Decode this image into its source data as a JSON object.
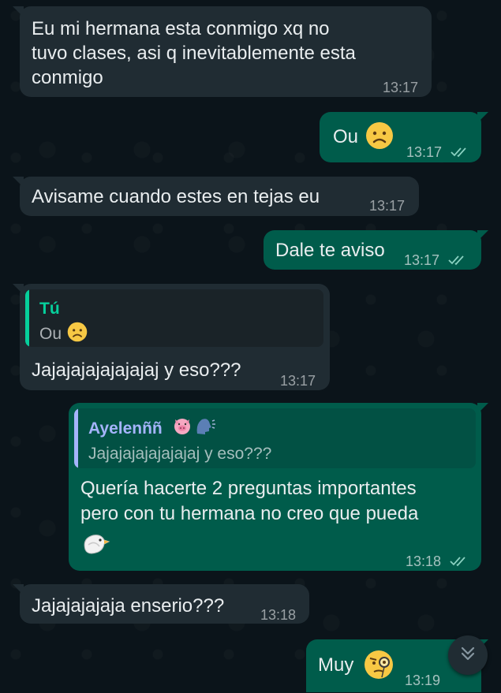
{
  "messages": [
    {
      "text_lines": [
        "Eu mi hermana esta conmigo xq no",
        "tuvo clases,  asi q inevitablemente esta",
        "conmigo"
      ],
      "time": "13:17",
      "direction": "incoming"
    },
    {
      "text": "Ou",
      "emoji": "disappointed-face",
      "time": "13:17",
      "direction": "outgoing",
      "status": "read"
    },
    {
      "text": "Avisame cuando estes en tejas eu",
      "time": "13:17",
      "direction": "incoming"
    },
    {
      "text": "Dale te aviso",
      "time": "13:17",
      "direction": "outgoing",
      "status": "read"
    },
    {
      "quote_author": "Tú",
      "quote_text": "Ou",
      "quote_emoji": "disappointed-face",
      "text": "Jajajajajajajajaj y eso???",
      "time": "13:17",
      "direction": "incoming"
    },
    {
      "quote_author": "Ayelenññ",
      "quote_author_emojis": [
        "pig-face",
        "speaking-head"
      ],
      "quote_text": "Jajajajajajajajaj y eso???",
      "text_lines": [
        "Quería hacerte 2 preguntas importantes",
        "pero con tu hermana no creo que pueda"
      ],
      "emoji": "dove",
      "time": "13:18",
      "direction": "outgoing",
      "status": "read"
    },
    {
      "text": "Jajajajajaja enserio???",
      "time": "13:18",
      "direction": "incoming"
    },
    {
      "text": "Muy",
      "emoji": "face-with-monocle",
      "time": "13:19",
      "direction": "outgoing",
      "status": "read"
    }
  ],
  "colors": {
    "background": "#0b141a",
    "incoming_bubble": "#202c33",
    "outgoing_bubble": "#005c4b",
    "quote_self": "#06cf9c",
    "quote_contact": "#a5b4fc",
    "read_ticks": "#8696a0"
  },
  "icons": {
    "scroll_down": "double-chevron-down-icon"
  }
}
